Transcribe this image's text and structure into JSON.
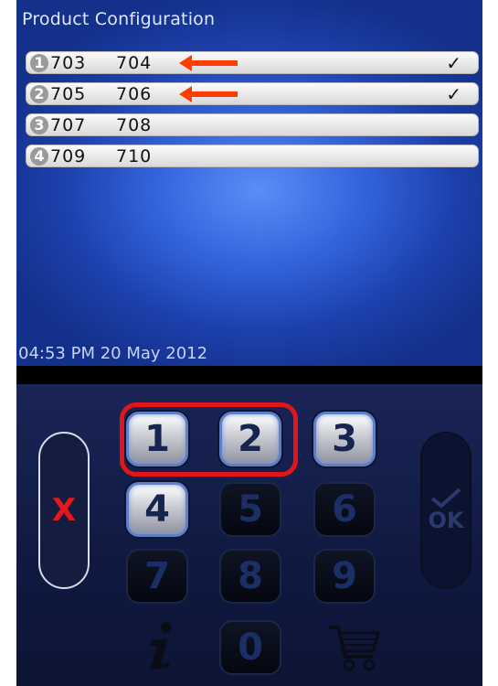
{
  "screen": {
    "title": "Product Configuration",
    "rows": [
      {
        "num": "1",
        "code_a": "703",
        "code_b": "704",
        "check": "✓"
      },
      {
        "num": "2",
        "code_a": "705",
        "code_b": "706",
        "check": "✓"
      },
      {
        "num": "3",
        "code_a": "707",
        "code_b": "708",
        "check": ""
      },
      {
        "num": "4",
        "code_a": "709",
        "code_b": "710",
        "check": ""
      }
    ],
    "datetime": "04:53 PM 20 May 2012"
  },
  "keypad": {
    "keys": [
      {
        "label": "1",
        "state": "active"
      },
      {
        "label": "2",
        "state": "active"
      },
      {
        "label": "3",
        "state": "active"
      },
      {
        "label": "4",
        "state": "active"
      },
      {
        "label": "5",
        "state": "inactive"
      },
      {
        "label": "6",
        "state": "inactive"
      },
      {
        "label": "7",
        "state": "inactive"
      },
      {
        "label": "8",
        "state": "inactive"
      },
      {
        "label": "9",
        "state": "inactive"
      },
      {
        "label": "0",
        "state": "inactive"
      }
    ],
    "cancel_label": "X",
    "ok_label": "OK",
    "icons": [
      "info-icon",
      "cart-icon",
      "checkmark-icon"
    ]
  },
  "annotations": {
    "arrow_color": "#ff3d00",
    "highlight_color": "#e2151b"
  }
}
